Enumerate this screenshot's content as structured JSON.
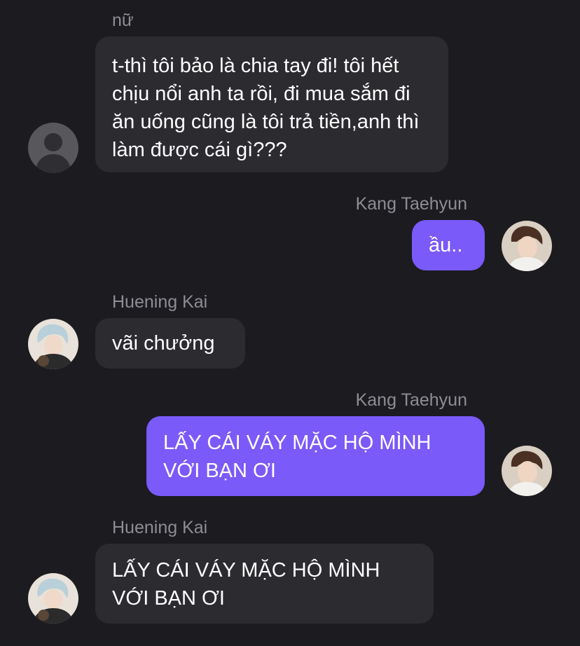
{
  "messages": [
    {
      "sender": "nữ",
      "text": "t-thì tôi bảo là chia tay đi! tôi hết chịu nổi anh ta rồi, đi mua sắm đi ăn uống cũng là tôi trả tiền,anh thì làm được cái gì???",
      "direction": "incoming",
      "avatar_icon": "default-person-icon"
    },
    {
      "sender": "Kang Taehyun",
      "text": "ầu..",
      "direction": "outgoing",
      "avatar_icon": "photo-avatar-icon"
    },
    {
      "sender": "Huening Kai",
      "text": "vãi chưởng",
      "direction": "incoming",
      "avatar_icon": "photo-avatar-icon"
    },
    {
      "sender": "Kang Taehyun",
      "text": "LẤY CÁI VÁY MẶC HỘ MÌNH VỚI BẠN ƠI",
      "direction": "outgoing",
      "avatar_icon": "photo-avatar-icon"
    },
    {
      "sender": "Huening Kai",
      "text": "LẤY CÁI VÁY MẶC HỘ MÌNH VỚI BẠN ƠI",
      "direction": "incoming",
      "avatar_icon": "photo-avatar-icon"
    }
  ],
  "colors": {
    "background": "#1c1b20",
    "incoming_bubble": "#2c2b30",
    "outgoing_bubble": "#7a5af8",
    "sender_name": "#8e8d93",
    "text": "#ffffff"
  }
}
